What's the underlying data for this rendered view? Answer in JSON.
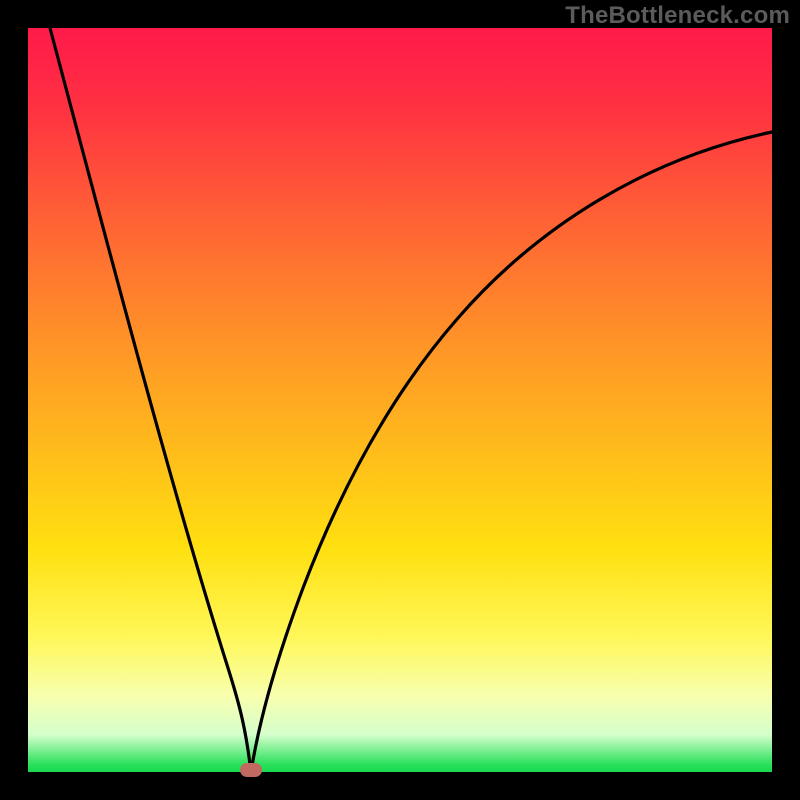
{
  "watermark": "TheBottleneck.com",
  "chart_data": {
    "type": "line",
    "title": "",
    "xlabel": "",
    "ylabel": "",
    "xlim": [
      0,
      100
    ],
    "ylim": [
      0,
      100
    ],
    "grid": false,
    "legend": false,
    "series": [
      {
        "name": "left-branch",
        "x": [
          3,
          6,
          10,
          14,
          18,
          22,
          26,
          30
        ],
        "values": [
          100,
          83,
          67,
          50,
          35,
          20,
          8,
          0
        ]
      },
      {
        "name": "right-branch",
        "x": [
          30,
          34,
          38,
          44,
          52,
          62,
          74,
          88,
          100
        ],
        "values": [
          0,
          14,
          30,
          46,
          60,
          70,
          78,
          83,
          86
        ]
      }
    ],
    "marker": {
      "x": 30,
      "y": 0,
      "color": "#c06a62"
    },
    "background_gradient": {
      "top": "#ff1a4a",
      "mid": "#ffbf1a",
      "lower": "#fff85a",
      "bottom": "#18d850"
    },
    "line_color": "#000000"
  }
}
